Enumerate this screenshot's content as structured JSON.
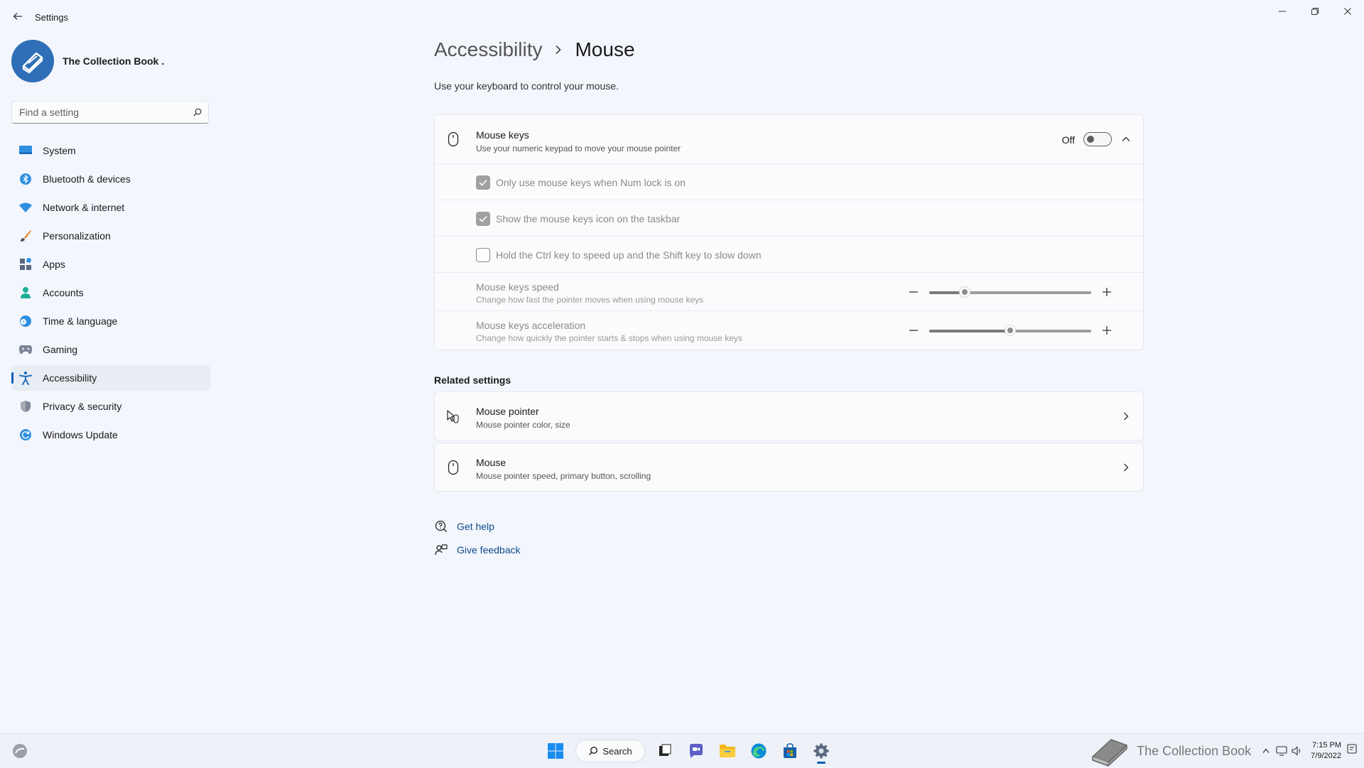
{
  "window": {
    "title": "Settings"
  },
  "profile": {
    "name": "The Collection Book ."
  },
  "search": {
    "placeholder": "Find a setting"
  },
  "sidebar": {
    "items": [
      {
        "label": "System",
        "icon": "system-icon"
      },
      {
        "label": "Bluetooth & devices",
        "icon": "bluetooth-icon"
      },
      {
        "label": "Network & internet",
        "icon": "wifi-icon"
      },
      {
        "label": "Personalization",
        "icon": "brush-icon"
      },
      {
        "label": "Apps",
        "icon": "apps-icon"
      },
      {
        "label": "Accounts",
        "icon": "person-icon"
      },
      {
        "label": "Time & language",
        "icon": "clock-globe-icon"
      },
      {
        "label": "Gaming",
        "icon": "gamepad-icon"
      },
      {
        "label": "Accessibility",
        "icon": "accessibility-icon",
        "active": true
      },
      {
        "label": "Privacy & security",
        "icon": "shield-icon"
      },
      {
        "label": "Windows Update",
        "icon": "update-icon"
      }
    ]
  },
  "page": {
    "breadcrumb_parent": "Accessibility",
    "breadcrumb_current": "Mouse",
    "subtitle": "Use your keyboard to control your mouse."
  },
  "mouse_keys": {
    "title": "Mouse keys",
    "description": "Use your numeric keypad to move your mouse pointer",
    "toggle_label": "Off",
    "enabled": false,
    "options": [
      {
        "label": "Only use mouse keys when Num lock is on",
        "checked": true
      },
      {
        "label": "Show the mouse keys icon on the taskbar",
        "checked": true
      },
      {
        "label": "Hold the Ctrl key to speed up and the Shift key to slow down",
        "checked": false
      }
    ],
    "speed": {
      "title": "Mouse keys speed",
      "description": "Change how fast the pointer moves when using mouse keys",
      "value_fraction": 0.22
    },
    "acceleration": {
      "title": "Mouse keys acceleration",
      "description": "Change how quickly the pointer starts & stops when using mouse keys",
      "value_fraction": 0.5
    }
  },
  "related": {
    "title": "Related settings",
    "items": [
      {
        "title": "Mouse pointer",
        "description": "Mouse pointer color, size"
      },
      {
        "title": "Mouse",
        "description": "Mouse pointer speed, primary button, scrolling"
      }
    ]
  },
  "help": {
    "get_help": "Get help",
    "give_feedback": "Give feedback"
  },
  "taskbar": {
    "search_label": "Search",
    "tray_brand": "The Collection Book",
    "time": "7:15 PM",
    "date": "7/9/2022"
  },
  "colors": {
    "accent": "#005fb8",
    "avatar": "#2e6fb7",
    "background": "#f3f6fc"
  }
}
